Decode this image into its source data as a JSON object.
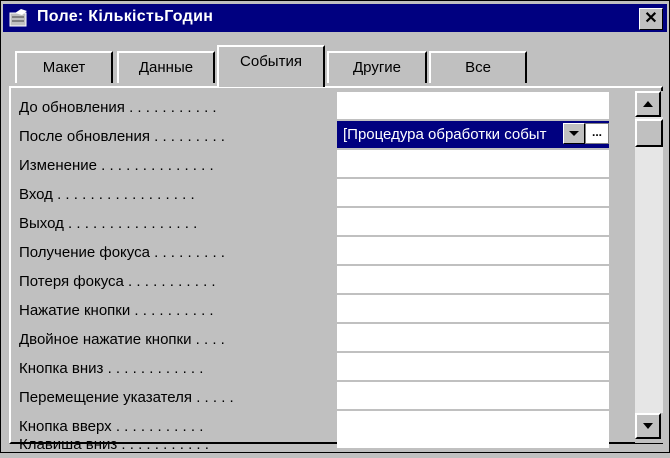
{
  "window": {
    "title": "Поле: КількістьГодин",
    "close_label": "✕"
  },
  "tabs": [
    {
      "label": "Макет"
    },
    {
      "label": "Данные"
    },
    {
      "label": "События"
    },
    {
      "label": "Другие"
    },
    {
      "label": "Все"
    }
  ],
  "properties": [
    {
      "label": "До обновления . . . . . . . . . . .",
      "value": ""
    },
    {
      "label": "После обновления . . . . . . . . .",
      "value": "[Процедура обработки событ"
    },
    {
      "label": "Изменение . . . . . . . . . . . . . .",
      "value": ""
    },
    {
      "label": "Вход . . . . . . . . . . . . . . . . .",
      "value": ""
    },
    {
      "label": "Выход . . . . . . . . . . . . . . . .",
      "value": ""
    },
    {
      "label": "Получение фокуса . . . . . . . . .",
      "value": ""
    },
    {
      "label": "Потеря фокуса . . . . . . . . . . .",
      "value": ""
    },
    {
      "label": "Нажатие кнопки . . . . . . . . . .",
      "value": ""
    },
    {
      "label": "Двойное нажатие кнопки . . . .",
      "value": ""
    },
    {
      "label": "Кнопка вниз . . . . . . . . . . . .",
      "value": ""
    },
    {
      "label": "Перемещение указателя . . . . .",
      "value": ""
    },
    {
      "label": "Кнопка вверх . . . . . . . . . . .",
      "value": ""
    },
    {
      "label": "Клавиша вниз . . . . . . . . . . .",
      "value": ""
    }
  ],
  "selected_row": 1,
  "build_label": "...",
  "colors": {
    "titlebar": "#000080",
    "selection": "#000080",
    "face": "#c0c0c0"
  }
}
